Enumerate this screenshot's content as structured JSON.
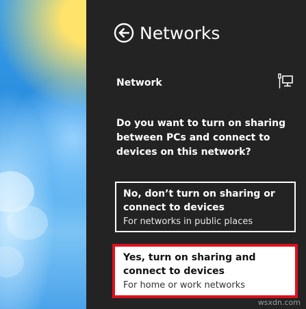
{
  "header": {
    "title": "Networks",
    "back_icon": "back-arrow-circle-icon"
  },
  "network": {
    "label": "Network",
    "icon": "wired-network-monitor-icon"
  },
  "prompt": {
    "question": "Do you want to turn on sharing between PCs and connect to devices on this network?"
  },
  "options": [
    {
      "title": "No, don’t turn on sharing or connect to devices",
      "description": "For networks in public places"
    },
    {
      "title": "Yes, turn on sharing and connect to devices",
      "description": "For home or work networks"
    }
  ],
  "colors": {
    "panel_background": "#232323",
    "highlight_border": "#e0101c",
    "text": "#ffffff"
  },
  "watermark": "wsxdn.com"
}
